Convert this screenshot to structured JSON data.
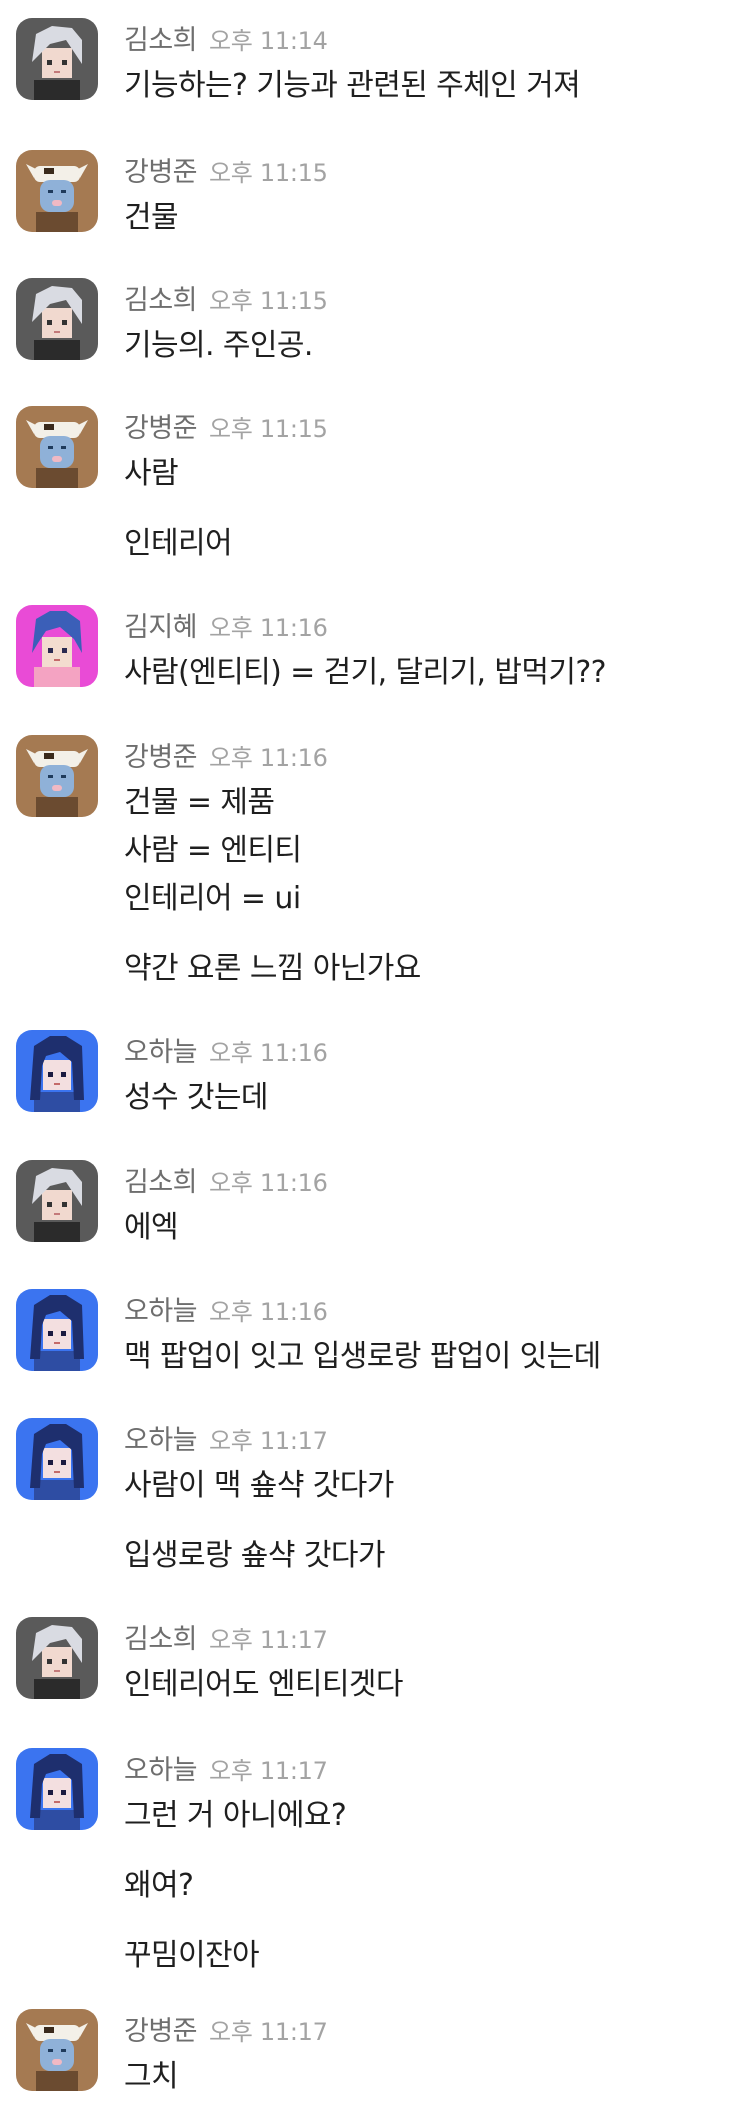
{
  "colors": {
    "name": "#6e6e6e",
    "time": "#a3a3a3",
    "text": "#1f1f1f",
    "background": "#ffffff"
  },
  "messages": [
    {
      "user": "김소희",
      "avatar": "silver-hair-avatar",
      "time": "오후 11:14",
      "lines": [
        [
          "기능하는? 기능과 관련된 주체인 거져"
        ]
      ]
    },
    {
      "user": "강병준",
      "avatar": "cow-hood-avatar",
      "time": "오후 11:15",
      "lines": [
        [
          "건물"
        ]
      ]
    },
    {
      "user": "김소희",
      "avatar": "silver-hair-avatar",
      "time": "오후 11:15",
      "lines": [
        [
          "기능의. 주인공."
        ]
      ]
    },
    {
      "user": "강병준",
      "avatar": "cow-hood-avatar",
      "time": "오후 11:15",
      "lines": [
        [
          "사람"
        ],
        [
          "인테리어"
        ]
      ]
    },
    {
      "user": "김지혜",
      "avatar": "blue-hair-pink-bg-avatar",
      "time": "오후 11:16",
      "lines": [
        [
          "사람(엔티티) = 걷기, 달리기, 밥먹기??"
        ]
      ]
    },
    {
      "user": "강병준",
      "avatar": "cow-hood-avatar",
      "time": "오후 11:16",
      "lines": [
        [
          "건물 = 제품",
          "사람 = 엔티티",
          "인테리어 = ui"
        ],
        [
          "약간 요론 느낌 아닌가요"
        ]
      ]
    },
    {
      "user": "오하늘",
      "avatar": "navy-hair-blue-bg-avatar",
      "time": "오후 11:16",
      "lines": [
        [
          "성수 갓는데"
        ]
      ]
    },
    {
      "user": "김소희",
      "avatar": "silver-hair-avatar",
      "time": "오후 11:16",
      "lines": [
        [
          "에엑"
        ]
      ]
    },
    {
      "user": "오하늘",
      "avatar": "navy-hair-blue-bg-avatar",
      "time": "오후 11:16",
      "lines": [
        [
          "맥 팝업이 잇고 입생로랑 팝업이 잇는데"
        ]
      ]
    },
    {
      "user": "오하늘",
      "avatar": "navy-hair-blue-bg-avatar",
      "time": "오후 11:17",
      "lines": [
        [
          "사람이 맥 숖샥 갓다가"
        ],
        [
          "입생로랑 숖샥 갓다가"
        ]
      ]
    },
    {
      "user": "김소희",
      "avatar": "silver-hair-avatar",
      "time": "오후 11:17",
      "lines": [
        [
          "인테리어도 엔티티겟다"
        ]
      ]
    },
    {
      "user": "오하늘",
      "avatar": "navy-hair-blue-bg-avatar",
      "time": "오후 11:17",
      "lines": [
        [
          "그런 거 아니에요?"
        ],
        [
          "왜여?"
        ],
        [
          "꾸밈이잔아"
        ]
      ]
    },
    {
      "user": "강병준",
      "avatar": "cow-hood-avatar",
      "time": "오후 11:17",
      "lines": [
        [
          "그치"
        ]
      ]
    }
  ]
}
